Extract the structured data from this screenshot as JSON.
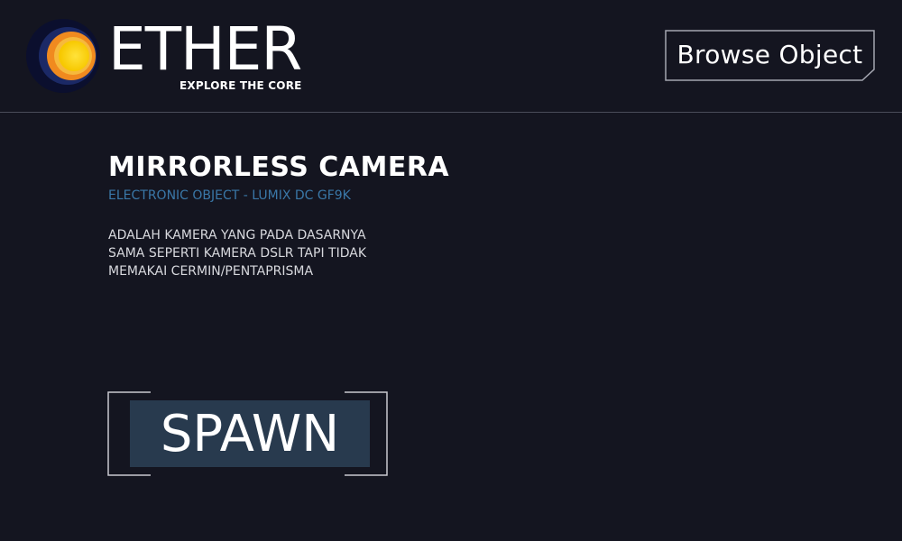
{
  "header": {
    "logo": {
      "wordmark": "ETHER",
      "tagline": "EXPLORE THE CORE"
    },
    "browse_button_label": "Browse Object"
  },
  "object": {
    "title": "MIRRORLESS CAMERA",
    "subtitle": "ELECTRONIC OBJECT - LUMIX DC GF9K",
    "description": "ADALAH KAMERA YANG PADA DASARNYA SAMA SEPERTI KAMERA DSLR TAPI TIDAK MEMAKAI CERMIN/PENTAPRISMA"
  },
  "spawn_button_label": "SPAWN",
  "colors": {
    "background": "#141520",
    "divider": "#4a4c5a",
    "subtitle_accent": "#3a78a8",
    "spawn_button_fill": "#283a4e",
    "logo_outer": "#f08a1f",
    "logo_inner": "#ffd21a"
  },
  "icons": {
    "logo_mark": "earth-core-icon"
  }
}
